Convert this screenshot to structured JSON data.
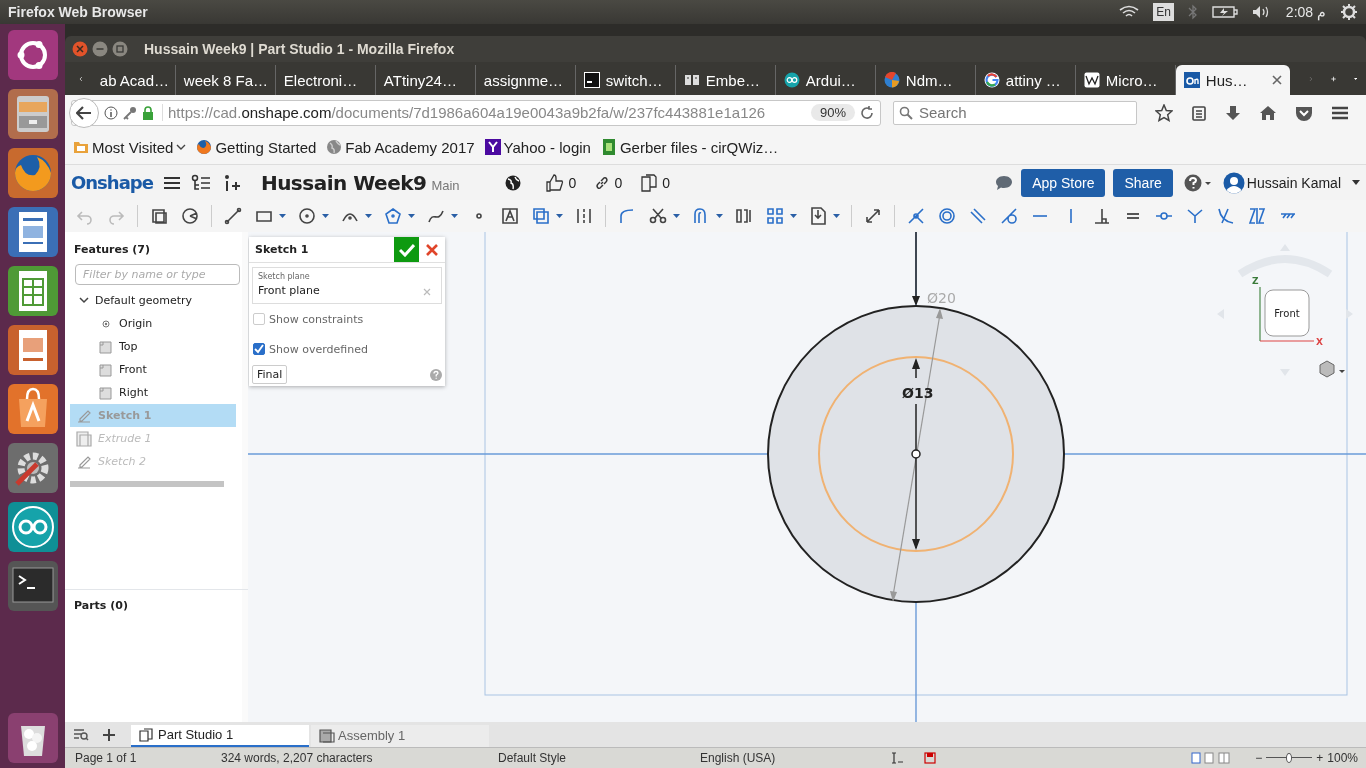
{
  "os_bar": {
    "title": "Firefox Web Browser",
    "keyboard": "En",
    "clock": "م 2:08"
  },
  "window": {
    "title": "Hussain Week9 | Part Studio 1 - Mozilla Firefox"
  },
  "tabs": [
    {
      "label": "ab Acad…",
      "kind": "plain",
      "selected": false
    },
    {
      "label": "week 8 Fa…",
      "kind": "plain",
      "selected": false
    },
    {
      "label": "Electroni…",
      "kind": "plain",
      "selected": false
    },
    {
      "label": "ATtiny24…",
      "kind": "plain",
      "selected": false
    },
    {
      "label": "assignme…",
      "kind": "plain",
      "selected": false
    },
    {
      "label": "switch…",
      "kind": "terminal",
      "selected": false
    },
    {
      "label": "Embe…",
      "kind": "book",
      "selected": false
    },
    {
      "label": "Ardui…",
      "kind": "arduino",
      "selected": false
    },
    {
      "label": "Ndm…",
      "kind": "ball",
      "selected": false
    },
    {
      "label": "attiny …",
      "kind": "google",
      "selected": false
    },
    {
      "label": "Micro…",
      "kind": "wiki",
      "selected": false
    },
    {
      "label": "Hus…",
      "kind": "onshape",
      "selected": true
    }
  ],
  "address": {
    "scheme": "https://cad.",
    "host": "onshape.com",
    "path": "/documents/7d1986a604a19e0043a9b2fa/w/237fc443881e1a126",
    "zoom": "90%"
  },
  "search": {
    "placeholder": "Search"
  },
  "bookmarks": [
    {
      "label": "Most Visited",
      "kind": "folder"
    },
    {
      "label": "Getting Started",
      "kind": "firefox"
    },
    {
      "label": "Fab Academy 2017",
      "kind": "globe"
    },
    {
      "label": "Yahoo - login",
      "kind": "yahoo"
    },
    {
      "label": "Gerber files - cirQWiz…",
      "kind": "gerber"
    }
  ],
  "onshape": {
    "logo": "Onshape",
    "document": "Hussain Week9",
    "branch": "Main",
    "likes": "0",
    "links": "0",
    "copies": "0",
    "app_store": "App Store",
    "share": "Share",
    "user": "Hussain Kamal"
  },
  "features": {
    "title": "Features (7)",
    "filter_placeholder": "Filter by name or type",
    "items": [
      {
        "label": "Default geometry",
        "kind": "group",
        "expanded": true,
        "selected": false,
        "children": [
          {
            "label": "Origin",
            "kind": "origin",
            "selected": false
          },
          {
            "label": "Top",
            "kind": "plane",
            "selected": false
          },
          {
            "label": "Front",
            "kind": "plane",
            "selected": false
          },
          {
            "label": "Right",
            "kind": "plane",
            "selected": false
          }
        ]
      },
      {
        "label": "Sketch 1",
        "kind": "sketch",
        "selected": true,
        "rolled_back": false
      },
      {
        "label": "Extrude 1",
        "kind": "extrude",
        "selected": false,
        "rolled_back": true
      },
      {
        "label": "Sketch 2",
        "kind": "sketch",
        "selected": false,
        "rolled_back": true
      }
    ]
  },
  "parts": {
    "title": "Parts (0)"
  },
  "sketch_dialog": {
    "title": "Sketch 1",
    "plane_label": "Sketch plane",
    "plane": "Front plane",
    "options": [
      {
        "label": "Show constraints",
        "checked": false
      },
      {
        "label": "Show overdefined",
        "checked": true
      }
    ],
    "final": "Final"
  },
  "canvas": {
    "outer_dimension": "Ø20",
    "inner_dimension": "Ø13"
  },
  "view_cube": {
    "face": "Front",
    "axis_z": "Z",
    "axis_x": "X"
  },
  "bottom_tabs": [
    {
      "label": "Part Studio 1",
      "kind": "part",
      "selected": true
    },
    {
      "label": "Assembly 1",
      "kind": "assembly",
      "selected": false
    }
  ],
  "status_bar": {
    "page": "Page 1 of 1",
    "words": "324 words, 2,207 characters",
    "style": "Default Style",
    "language": "English (USA)",
    "zoom": "100%",
    "zoom_out": "−",
    "zoom_in": "+",
    "zoom_slider": {
      "level": 0.5
    }
  }
}
